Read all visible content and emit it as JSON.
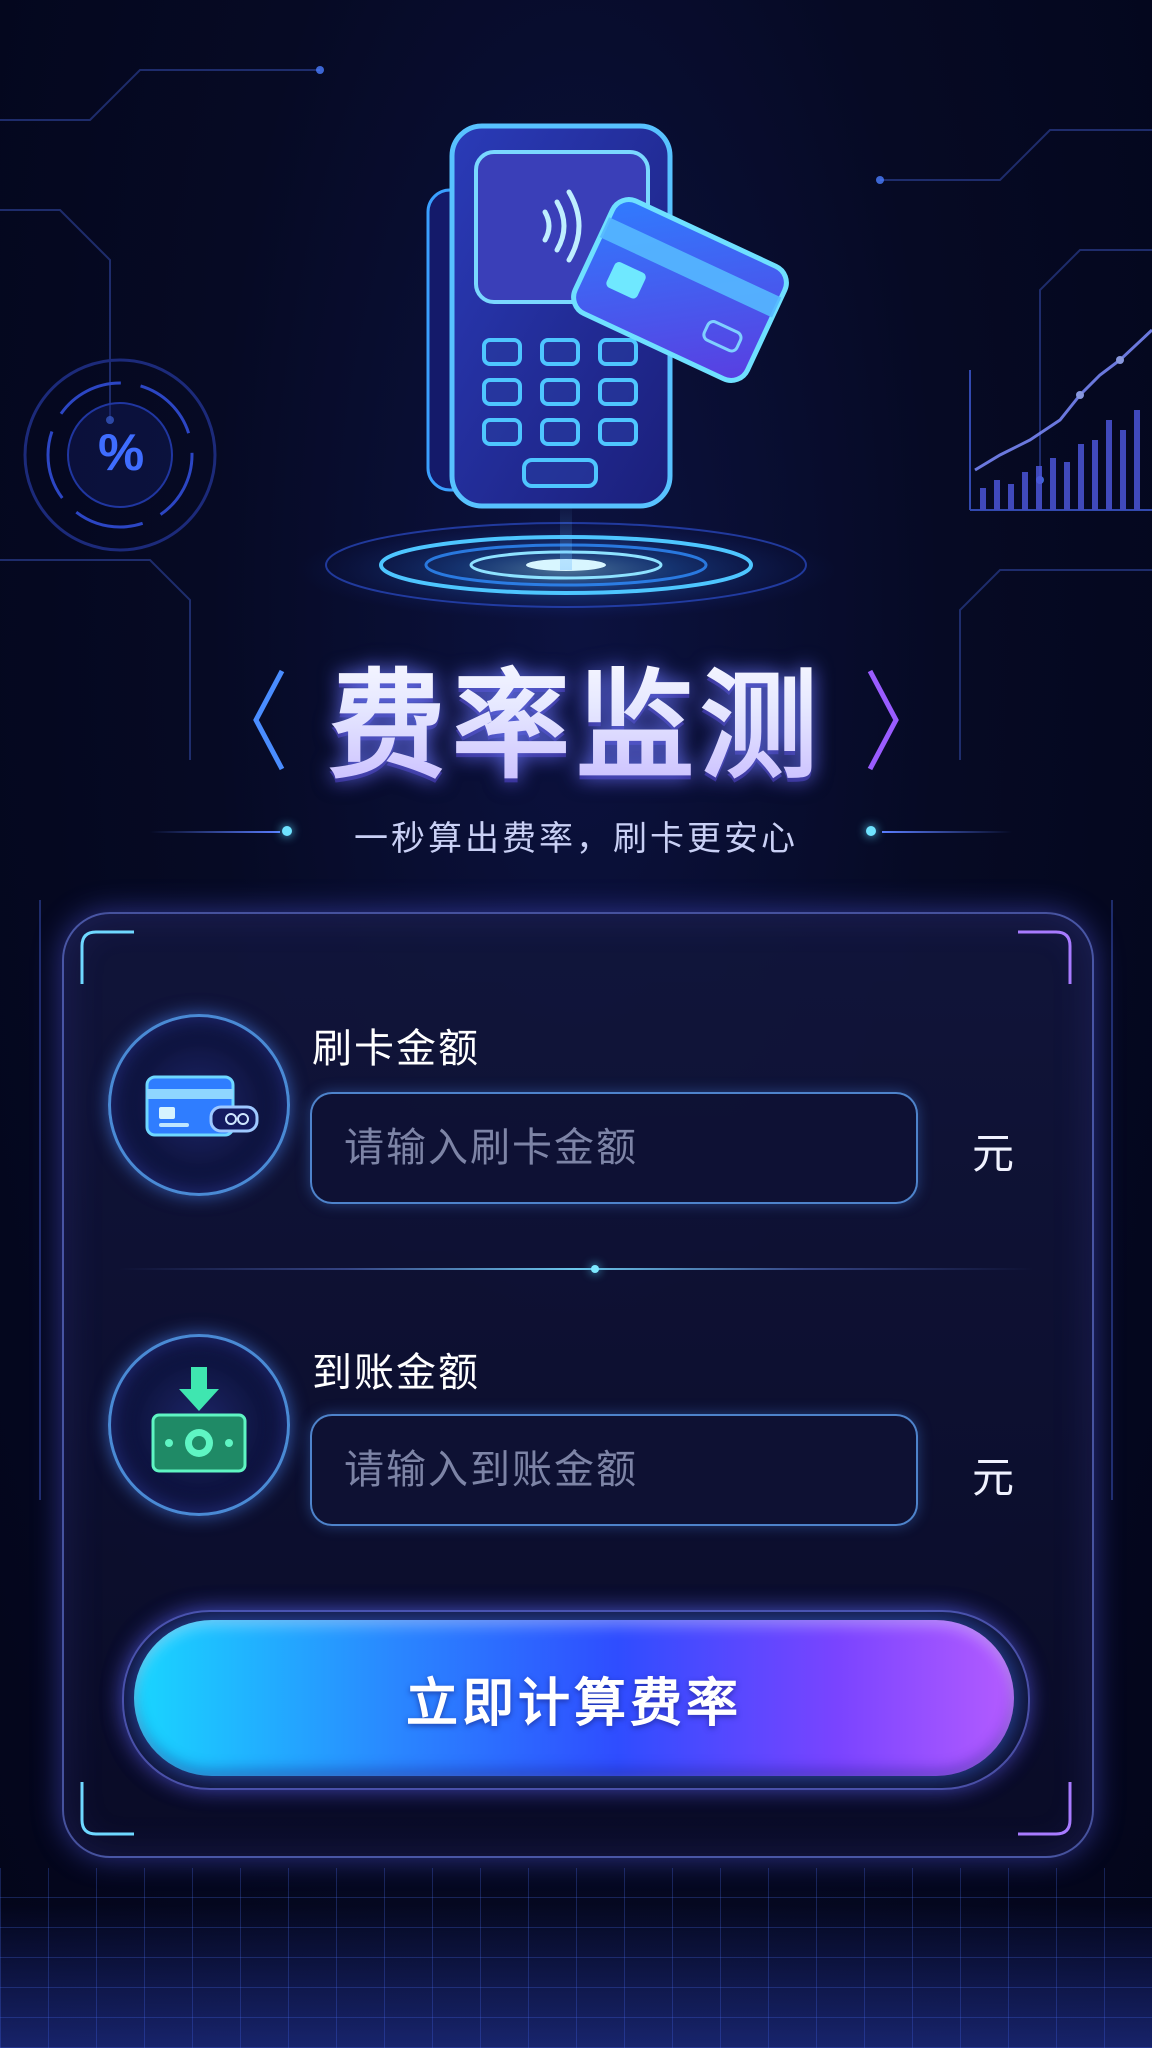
{
  "header": {
    "title": "费率监测",
    "subtitle": "一秒算出费率，刷卡更安心"
  },
  "form": {
    "swipe_amount": {
      "label": "刷卡金额",
      "placeholder": "请输入刷卡金额",
      "value": "",
      "unit": "元",
      "icon": "credit-card-icon"
    },
    "received_amount": {
      "label": "到账金额",
      "placeholder": "请输入到账金额",
      "value": "",
      "unit": "元",
      "icon": "cash-download-icon"
    },
    "calculate_button_label": "立即计算费率"
  },
  "decor": {
    "percent_symbol": "%",
    "hero_icon": "pos-terminal-icon",
    "chart_icon": "trend-chart-icon"
  },
  "colors": {
    "background": "#060a24",
    "accent_cyan": "#19d6ff",
    "accent_blue": "#2f4dff",
    "accent_purple": "#b45cff"
  }
}
